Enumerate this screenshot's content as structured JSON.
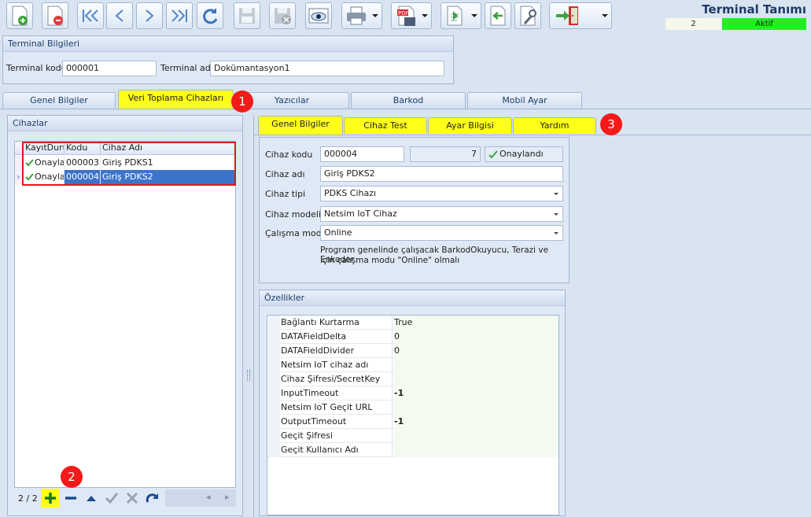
{
  "window": {
    "title": "Terminal Tanımı",
    "record_number": "2",
    "status": "Aktif"
  },
  "terminal": {
    "group_title": "Terminal Bilgileri",
    "code_label": "Terminal kodu",
    "code_value": "000001",
    "name_label": "Terminal adı",
    "name_value": "Dokümantasyon1"
  },
  "main_tabs": [
    {
      "label": "Genel Bilgiler"
    },
    {
      "label": "Veri Toplama Cihazları"
    },
    {
      "label": "Yazıcılar"
    },
    {
      "label": "Barkod"
    },
    {
      "label": "Mobil Ayar"
    }
  ],
  "callouts": [
    "1",
    "2",
    "3"
  ],
  "devices": {
    "title": "Cihazlar",
    "columns": [
      "KayıtDurumu",
      "Kodu",
      "Cihaz Adı"
    ],
    "rows": [
      {
        "status": "Onaylandı",
        "code": "000003",
        "name": "Giriş PDKS1"
      },
      {
        "status": "Onaylandı",
        "code": "000004",
        "name": "Giriş PDKS2"
      }
    ],
    "pager": "2 / 2"
  },
  "sub_tabs": [
    {
      "label": "Genel Bilgiler"
    },
    {
      "label": "Cihaz Test"
    },
    {
      "label": "Ayar Bilgisi"
    },
    {
      "label": "Yardım"
    }
  ],
  "device_form": {
    "code_label": "Cihaz kodu",
    "code_value": "000004",
    "seq_value": "7",
    "approved": "Onaylandı",
    "name_label": "Cihaz adı",
    "name_value": "Giriş PDKS2",
    "type_label": "Cihaz tipi",
    "type_value": "PDKS Cihazı",
    "model_label": "Cihaz modeli",
    "model_value": "Netsim IoT Cihaz",
    "mode_label": "Çalışma modu",
    "mode_value": "Online",
    "note_line1": "Program genelinde çalışacak BarkodOkuyucu, Terazi ve Enkoder",
    "note_line2": "için çalışma modu \"Online\" olmalı"
  },
  "properties": {
    "title": "Özellikler",
    "items": [
      {
        "name": "Bağlantı Kurtarma",
        "value": "True"
      },
      {
        "name": "DATAFieldDelta",
        "value": "0"
      },
      {
        "name": "DATAFieldDivider",
        "value": "0"
      },
      {
        "name": "Netsim IoT cihaz adı",
        "value": ""
      },
      {
        "name": "Cihaz Şifresi/SecretKey",
        "value": ""
      },
      {
        "name": "InputTimeout",
        "value": "-1"
      },
      {
        "name": "Netsim IoT Geçit URL",
        "value": ""
      },
      {
        "name": "OutputTimeout",
        "value": "-1"
      },
      {
        "name": "Geçit Şifresi",
        "value": ""
      },
      {
        "name": "Geçit Kullanıcı Adı",
        "value": ""
      }
    ]
  },
  "colors": {
    "highlight": "#ffff1a",
    "callout": "#f31a1a",
    "selection": "#3c74c9",
    "status_active": "#22ee22"
  }
}
